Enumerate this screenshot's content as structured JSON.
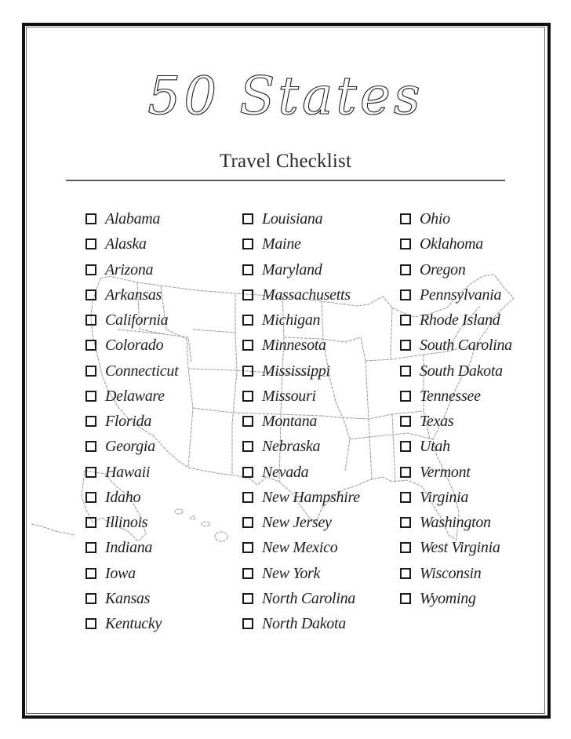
{
  "header": {
    "title": "50 States",
    "subtitle": "Travel Checklist"
  },
  "background": {
    "map_icon": "us-map-outline",
    "map_color": "#9a9a9a"
  },
  "colors": {
    "border": "#111111",
    "text": "#1e1e1e",
    "divider": "#5e5e5e"
  },
  "checklist": {
    "column_1": [
      {
        "label": "Alabama",
        "checked": false
      },
      {
        "label": "Alaska",
        "checked": false
      },
      {
        "label": "Arizona",
        "checked": false
      },
      {
        "label": "Arkansas",
        "checked": false
      },
      {
        "label": "California",
        "checked": false
      },
      {
        "label": "Colorado",
        "checked": false
      },
      {
        "label": "Connecticut",
        "checked": false
      },
      {
        "label": "Delaware",
        "checked": false
      },
      {
        "label": "Florida",
        "checked": false
      },
      {
        "label": "Georgia",
        "checked": false
      },
      {
        "label": "Hawaii",
        "checked": false
      },
      {
        "label": "Idaho",
        "checked": false
      },
      {
        "label": "Illinois",
        "checked": false
      },
      {
        "label": "Indiana",
        "checked": false
      },
      {
        "label": "Iowa",
        "checked": false
      },
      {
        "label": "Kansas",
        "checked": false
      },
      {
        "label": "Kentucky",
        "checked": false
      }
    ],
    "column_2": [
      {
        "label": "Louisiana",
        "checked": false
      },
      {
        "label": "Maine",
        "checked": false
      },
      {
        "label": "Maryland",
        "checked": false
      },
      {
        "label": "Massachusetts",
        "checked": false
      },
      {
        "label": "Michigan",
        "checked": false
      },
      {
        "label": "Minnesota",
        "checked": false
      },
      {
        "label": "Mississippi",
        "checked": false
      },
      {
        "label": "Missouri",
        "checked": false
      },
      {
        "label": "Montana",
        "checked": false
      },
      {
        "label": "Nebraska",
        "checked": false
      },
      {
        "label": "Nevada",
        "checked": false
      },
      {
        "label": "New Hampshire",
        "checked": false
      },
      {
        "label": "New Jersey",
        "checked": false
      },
      {
        "label": "New Mexico",
        "checked": false
      },
      {
        "label": "New York",
        "checked": false
      },
      {
        "label": "North Carolina",
        "checked": false
      },
      {
        "label": "North Dakota",
        "checked": false
      }
    ],
    "column_3": [
      {
        "label": "Ohio",
        "checked": false
      },
      {
        "label": "Oklahoma",
        "checked": false
      },
      {
        "label": "Oregon",
        "checked": false
      },
      {
        "label": "Pennsylvania",
        "checked": false
      },
      {
        "label": "Rhode Island",
        "checked": false
      },
      {
        "label": "South Carolina",
        "checked": false
      },
      {
        "label": "South Dakota",
        "checked": false
      },
      {
        "label": "Tennessee",
        "checked": false
      },
      {
        "label": "Texas",
        "checked": false
      },
      {
        "label": "Utah",
        "checked": false
      },
      {
        "label": "Vermont",
        "checked": false
      },
      {
        "label": "Virginia",
        "checked": false
      },
      {
        "label": "Washington",
        "checked": false
      },
      {
        "label": "West Virginia",
        "checked": false
      },
      {
        "label": "Wisconsin",
        "checked": false
      },
      {
        "label": "Wyoming",
        "checked": false
      }
    ]
  }
}
